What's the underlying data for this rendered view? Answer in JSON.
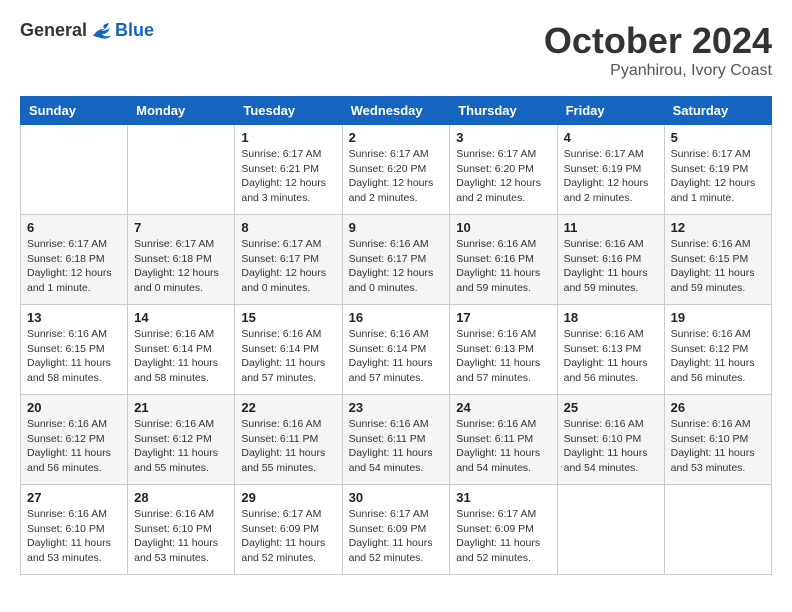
{
  "logo": {
    "general": "General",
    "blue": "Blue"
  },
  "title": "October 2024",
  "subtitle": "Pyanhirou, Ivory Coast",
  "days_header": [
    "Sunday",
    "Monday",
    "Tuesday",
    "Wednesday",
    "Thursday",
    "Friday",
    "Saturday"
  ],
  "weeks": [
    [
      {
        "day": "",
        "info": ""
      },
      {
        "day": "",
        "info": ""
      },
      {
        "day": "1",
        "info": "Sunrise: 6:17 AM\nSunset: 6:21 PM\nDaylight: 12 hours\nand 3 minutes."
      },
      {
        "day": "2",
        "info": "Sunrise: 6:17 AM\nSunset: 6:20 PM\nDaylight: 12 hours\nand 2 minutes."
      },
      {
        "day": "3",
        "info": "Sunrise: 6:17 AM\nSunset: 6:20 PM\nDaylight: 12 hours\nand 2 minutes."
      },
      {
        "day": "4",
        "info": "Sunrise: 6:17 AM\nSunset: 6:19 PM\nDaylight: 12 hours\nand 2 minutes."
      },
      {
        "day": "5",
        "info": "Sunrise: 6:17 AM\nSunset: 6:19 PM\nDaylight: 12 hours\nand 1 minute."
      }
    ],
    [
      {
        "day": "6",
        "info": "Sunrise: 6:17 AM\nSunset: 6:18 PM\nDaylight: 12 hours\nand 1 minute."
      },
      {
        "day": "7",
        "info": "Sunrise: 6:17 AM\nSunset: 6:18 PM\nDaylight: 12 hours\nand 0 minutes."
      },
      {
        "day": "8",
        "info": "Sunrise: 6:17 AM\nSunset: 6:17 PM\nDaylight: 12 hours\nand 0 minutes."
      },
      {
        "day": "9",
        "info": "Sunrise: 6:16 AM\nSunset: 6:17 PM\nDaylight: 12 hours\nand 0 minutes."
      },
      {
        "day": "10",
        "info": "Sunrise: 6:16 AM\nSunset: 6:16 PM\nDaylight: 11 hours\nand 59 minutes."
      },
      {
        "day": "11",
        "info": "Sunrise: 6:16 AM\nSunset: 6:16 PM\nDaylight: 11 hours\nand 59 minutes."
      },
      {
        "day": "12",
        "info": "Sunrise: 6:16 AM\nSunset: 6:15 PM\nDaylight: 11 hours\nand 59 minutes."
      }
    ],
    [
      {
        "day": "13",
        "info": "Sunrise: 6:16 AM\nSunset: 6:15 PM\nDaylight: 11 hours\nand 58 minutes."
      },
      {
        "day": "14",
        "info": "Sunrise: 6:16 AM\nSunset: 6:14 PM\nDaylight: 11 hours\nand 58 minutes."
      },
      {
        "day": "15",
        "info": "Sunrise: 6:16 AM\nSunset: 6:14 PM\nDaylight: 11 hours\nand 57 minutes."
      },
      {
        "day": "16",
        "info": "Sunrise: 6:16 AM\nSunset: 6:14 PM\nDaylight: 11 hours\nand 57 minutes."
      },
      {
        "day": "17",
        "info": "Sunrise: 6:16 AM\nSunset: 6:13 PM\nDaylight: 11 hours\nand 57 minutes."
      },
      {
        "day": "18",
        "info": "Sunrise: 6:16 AM\nSunset: 6:13 PM\nDaylight: 11 hours\nand 56 minutes."
      },
      {
        "day": "19",
        "info": "Sunrise: 6:16 AM\nSunset: 6:12 PM\nDaylight: 11 hours\nand 56 minutes."
      }
    ],
    [
      {
        "day": "20",
        "info": "Sunrise: 6:16 AM\nSunset: 6:12 PM\nDaylight: 11 hours\nand 56 minutes."
      },
      {
        "day": "21",
        "info": "Sunrise: 6:16 AM\nSunset: 6:12 PM\nDaylight: 11 hours\nand 55 minutes."
      },
      {
        "day": "22",
        "info": "Sunrise: 6:16 AM\nSunset: 6:11 PM\nDaylight: 11 hours\nand 55 minutes."
      },
      {
        "day": "23",
        "info": "Sunrise: 6:16 AM\nSunset: 6:11 PM\nDaylight: 11 hours\nand 54 minutes."
      },
      {
        "day": "24",
        "info": "Sunrise: 6:16 AM\nSunset: 6:11 PM\nDaylight: 11 hours\nand 54 minutes."
      },
      {
        "day": "25",
        "info": "Sunrise: 6:16 AM\nSunset: 6:10 PM\nDaylight: 11 hours\nand 54 minutes."
      },
      {
        "day": "26",
        "info": "Sunrise: 6:16 AM\nSunset: 6:10 PM\nDaylight: 11 hours\nand 53 minutes."
      }
    ],
    [
      {
        "day": "27",
        "info": "Sunrise: 6:16 AM\nSunset: 6:10 PM\nDaylight: 11 hours\nand 53 minutes."
      },
      {
        "day": "28",
        "info": "Sunrise: 6:16 AM\nSunset: 6:10 PM\nDaylight: 11 hours\nand 53 minutes."
      },
      {
        "day": "29",
        "info": "Sunrise: 6:17 AM\nSunset: 6:09 PM\nDaylight: 11 hours\nand 52 minutes."
      },
      {
        "day": "30",
        "info": "Sunrise: 6:17 AM\nSunset: 6:09 PM\nDaylight: 11 hours\nand 52 minutes."
      },
      {
        "day": "31",
        "info": "Sunrise: 6:17 AM\nSunset: 6:09 PM\nDaylight: 11 hours\nand 52 minutes."
      },
      {
        "day": "",
        "info": ""
      },
      {
        "day": "",
        "info": ""
      }
    ]
  ]
}
